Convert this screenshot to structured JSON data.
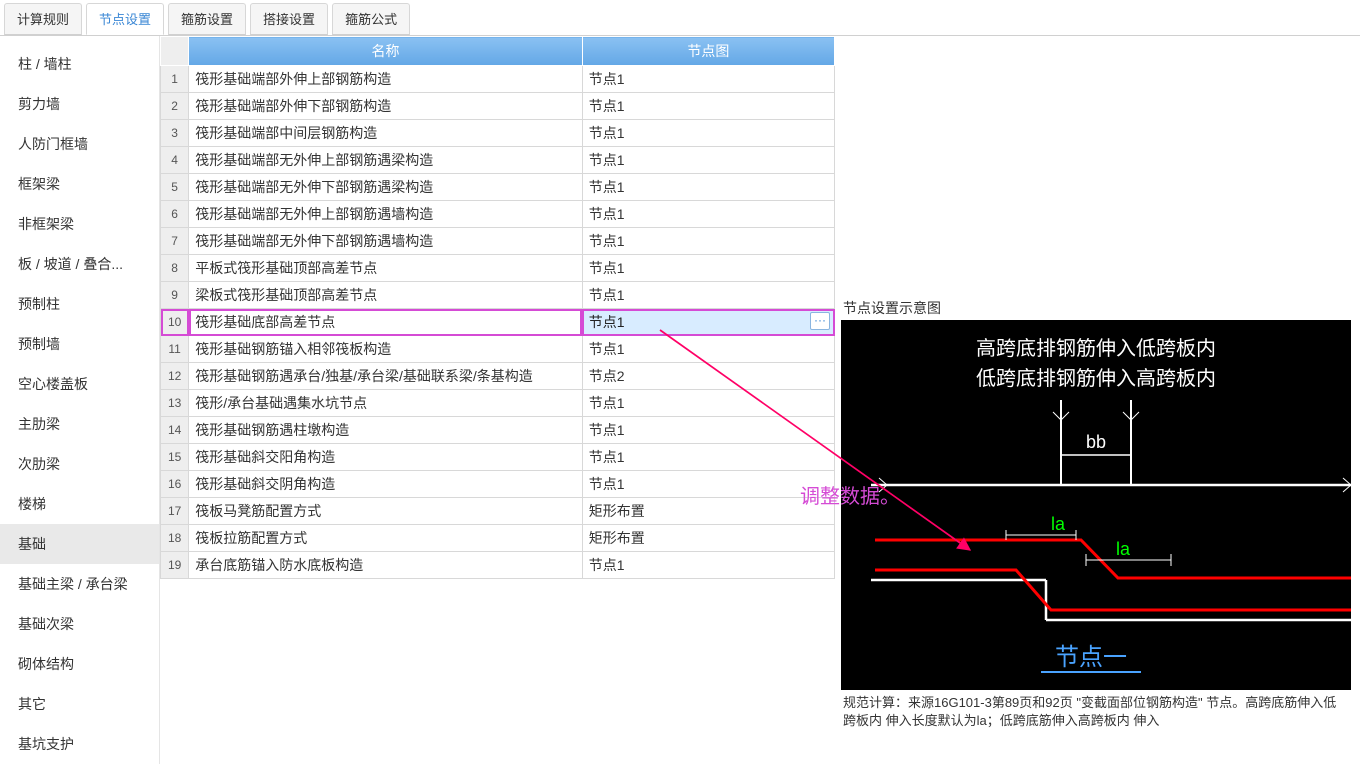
{
  "tabs": {
    "items": [
      "计算规则",
      "节点设置",
      "箍筋设置",
      "搭接设置",
      "箍筋公式"
    ],
    "active_index": 1
  },
  "sidebar": {
    "items": [
      "柱 / 墙柱",
      "剪力墙",
      "人防门框墙",
      "框架梁",
      "非框架梁",
      "板 / 坡道 / 叠合...",
      "预制柱",
      "预制墙",
      "空心楼盖板",
      "主肋梁",
      "次肋梁",
      "楼梯",
      "基础",
      "基础主梁 / 承台梁",
      "基础次梁",
      "砌体结构",
      "其它",
      "基坑支护"
    ],
    "selected_index": 12
  },
  "table": {
    "headers": {
      "name": "名称",
      "node": "节点图"
    },
    "rows": [
      {
        "n": "1",
        "name": "筏形基础端部外伸上部钢筋构造",
        "node": "节点1"
      },
      {
        "n": "2",
        "name": "筏形基础端部外伸下部钢筋构造",
        "node": "节点1"
      },
      {
        "n": "3",
        "name": "筏形基础端部中间层钢筋构造",
        "node": "节点1"
      },
      {
        "n": "4",
        "name": "筏形基础端部无外伸上部钢筋遇梁构造",
        "node": "节点1"
      },
      {
        "n": "5",
        "name": "筏形基础端部无外伸下部钢筋遇梁构造",
        "node": "节点1"
      },
      {
        "n": "6",
        "name": "筏形基础端部无外伸上部钢筋遇墙构造",
        "node": "节点1"
      },
      {
        "n": "7",
        "name": "筏形基础端部无外伸下部钢筋遇墙构造",
        "node": "节点1"
      },
      {
        "n": "8",
        "name": "平板式筏形基础顶部高差节点",
        "node": "节点1"
      },
      {
        "n": "9",
        "name": "梁板式筏形基础顶部高差节点",
        "node": "节点1"
      },
      {
        "n": "10",
        "name": "筏形基础底部高差节点",
        "node": "节点1",
        "hl": true
      },
      {
        "n": "11",
        "name": "筏形基础钢筋锚入相邻筏板构造",
        "node": "节点1"
      },
      {
        "n": "12",
        "name": "筏形基础钢筋遇承台/独基/承台梁/基础联系梁/条基构造",
        "node": "节点2"
      },
      {
        "n": "13",
        "name": "筏形/承台基础遇集水坑节点",
        "node": "节点1"
      },
      {
        "n": "14",
        "name": "筏形基础钢筋遇柱墩构造",
        "node": "节点1"
      },
      {
        "n": "15",
        "name": "筏形基础斜交阳角构造",
        "node": "节点1"
      },
      {
        "n": "16",
        "name": "筏形基础斜交阴角构造",
        "node": "节点1"
      },
      {
        "n": "17",
        "name": "筏板马凳筋配置方式",
        "node": "矩形布置"
      },
      {
        "n": "18",
        "name": "筏板拉筋配置方式",
        "node": "矩形布置"
      },
      {
        "n": "19",
        "name": "承台底筋锚入防水底板构造",
        "node": "节点1"
      }
    ],
    "highlight_index": 9,
    "dots_label": "···"
  },
  "annotation": {
    "label": "调整数据。"
  },
  "panel": {
    "title": "节点设置示意图",
    "line1": "高跨底排钢筋伸入低跨板内",
    "line2": "低跨底排钢筋伸入高跨板内",
    "bb": "bb",
    "la1": "la",
    "la2": "la",
    "node_label": "节点一",
    "spec": "规范计算：来源16G101-3第89页和92页 \"变截面部位钢筋构造\" 节点。高跨底筋伸入低跨板内 伸入长度默认为la；低跨底筋伸入高跨板内 伸入"
  }
}
